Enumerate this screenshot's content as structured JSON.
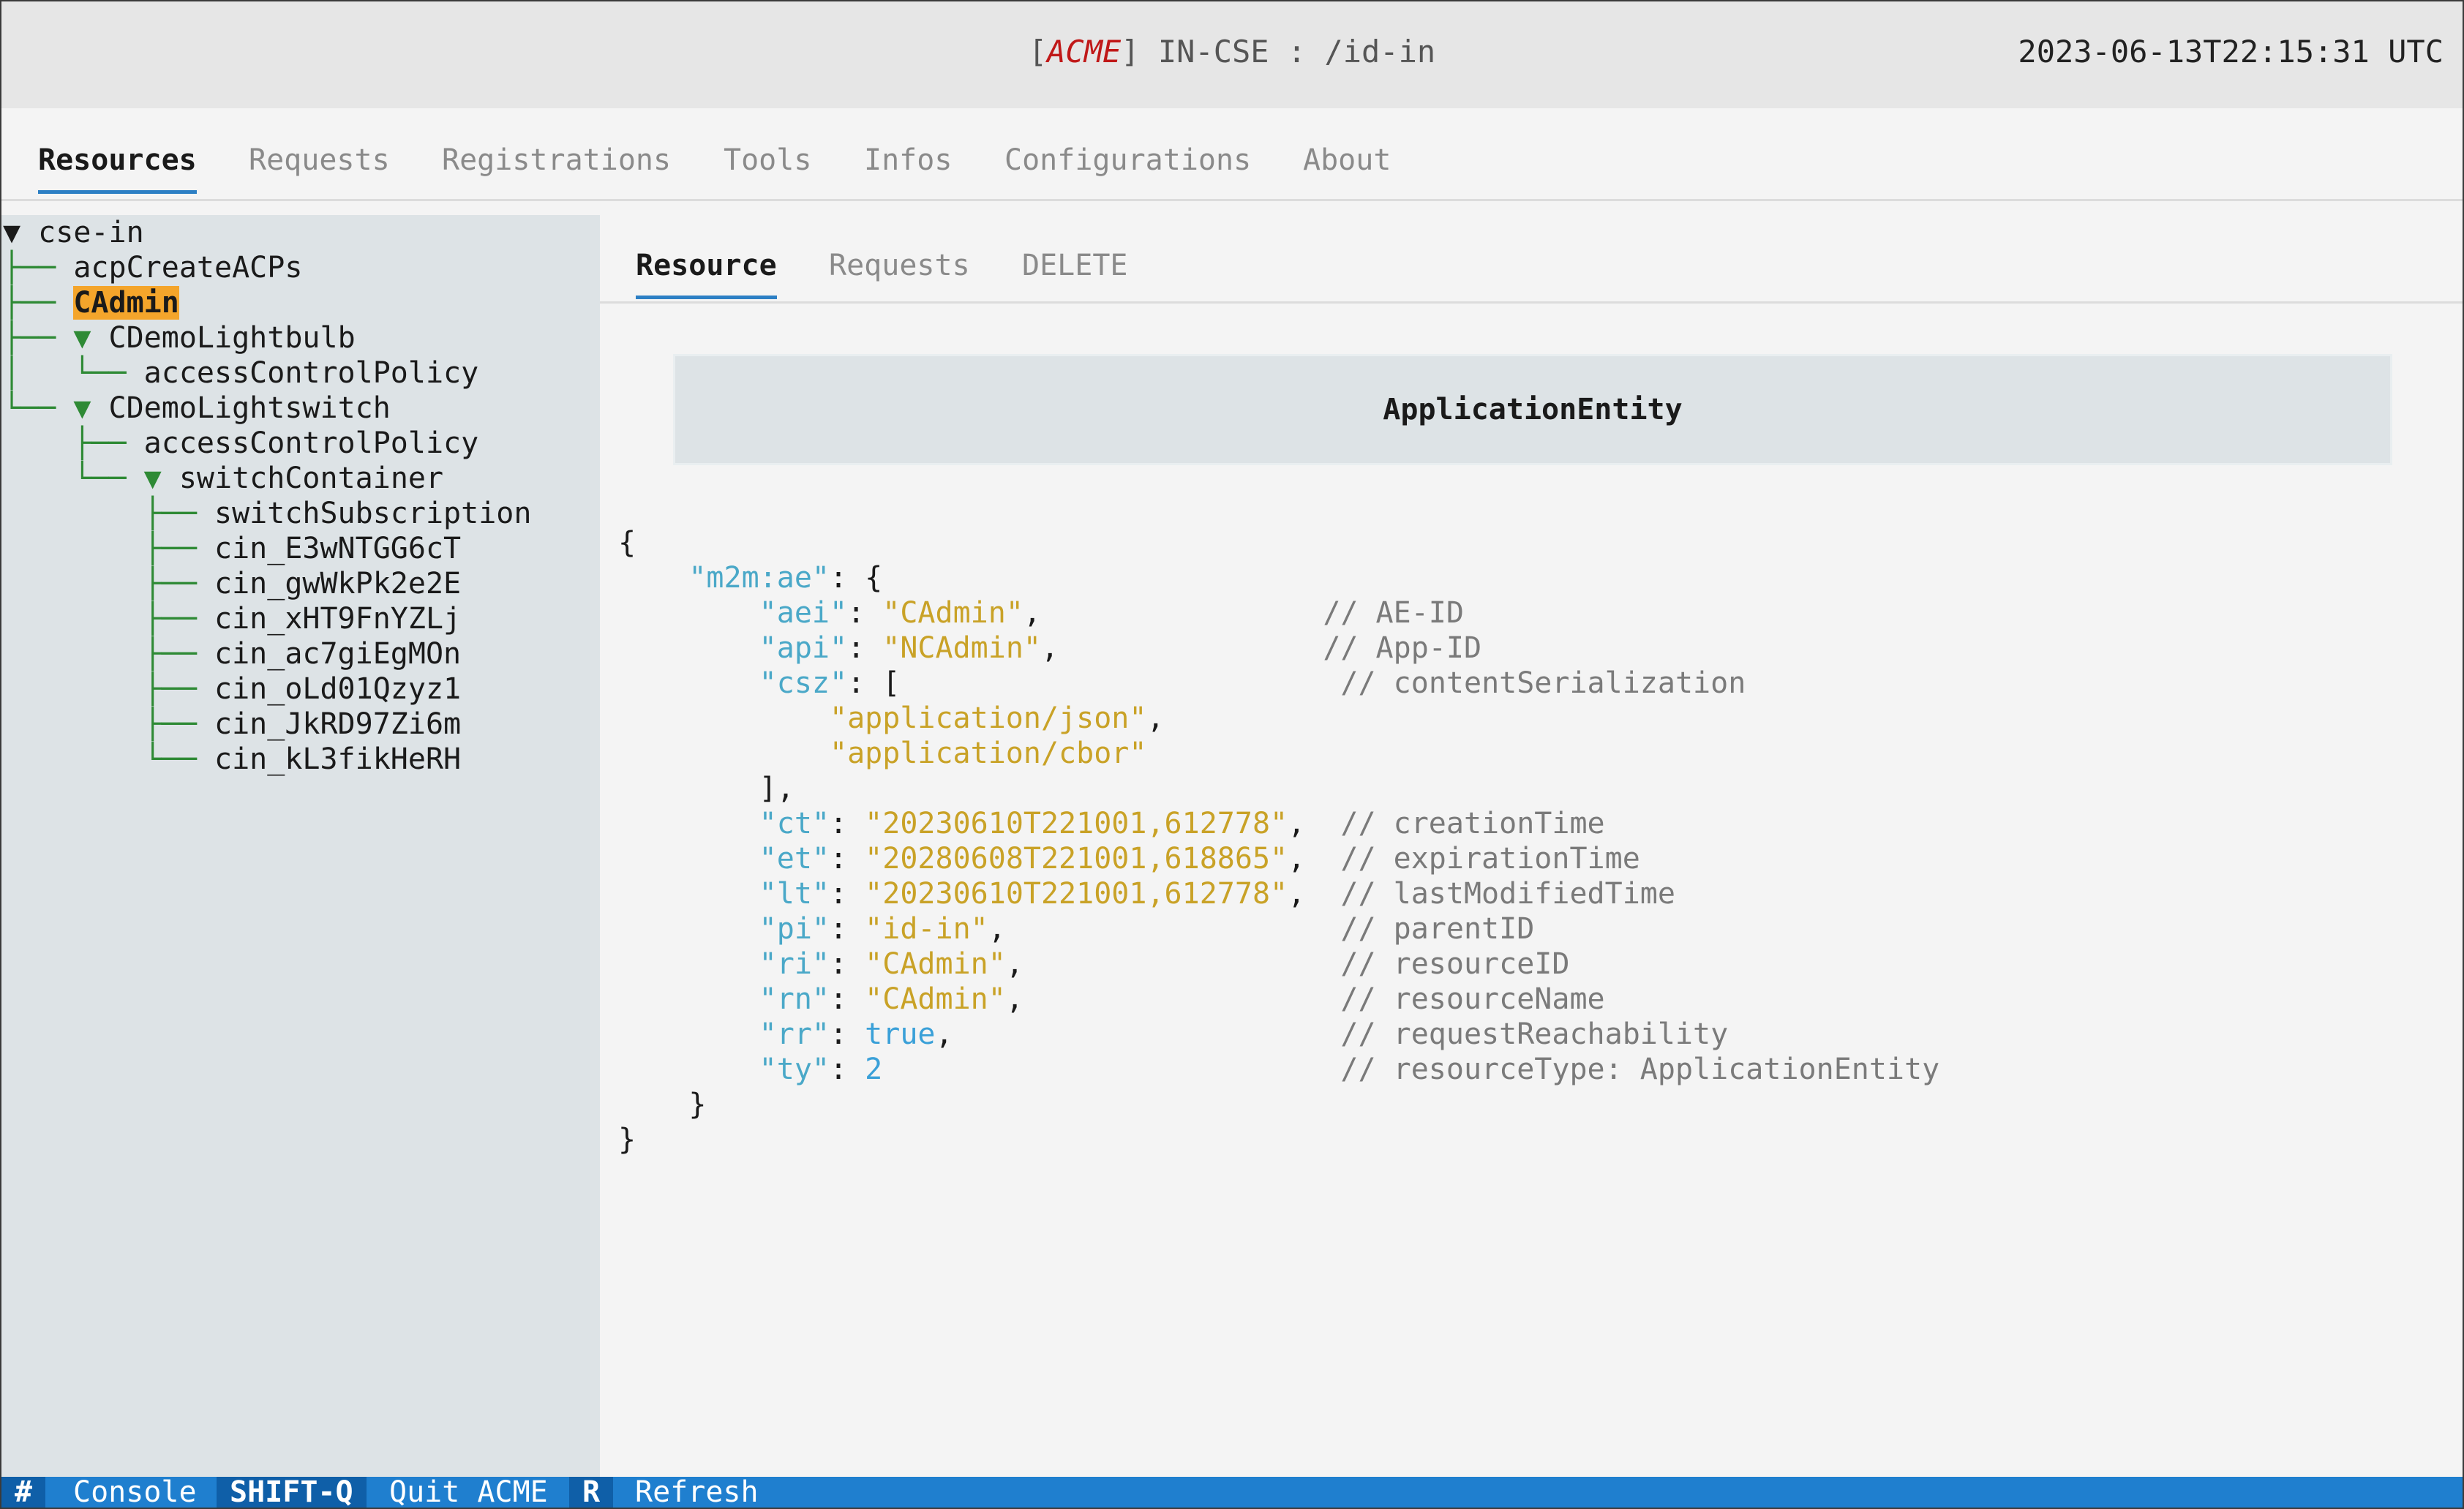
{
  "window": {
    "title_bracket_open": "[",
    "brand": "ACME",
    "title_rest": "] IN-CSE : /id-in",
    "clock": "2023-06-13T22:15:31 UTC"
  },
  "tabs": [
    {
      "label": "Resources",
      "active": true
    },
    {
      "label": "Requests"
    },
    {
      "label": "Registrations"
    },
    {
      "label": "Tools"
    },
    {
      "label": "Infos"
    },
    {
      "label": "Configurations"
    },
    {
      "label": "About"
    }
  ],
  "tree": [
    {
      "prefix": "▼ ",
      "label": "cse-in"
    },
    {
      "prefix": "├── ",
      "label": "acpCreateACPs"
    },
    {
      "prefix": "├── ",
      "label": "CAdmin",
      "selected": true
    },
    {
      "prefix": "├── ▼ ",
      "label": "CDemoLightbulb"
    },
    {
      "prefix": "│   └── ",
      "label": "accessControlPolicy"
    },
    {
      "prefix": "└── ▼ ",
      "label": "CDemoLightswitch"
    },
    {
      "prefix": "    ├── ",
      "label": "accessControlPolicy"
    },
    {
      "prefix": "    └── ▼ ",
      "label": "switchContainer"
    },
    {
      "prefix": "        ├── ",
      "label": "switchSubscription"
    },
    {
      "prefix": "        ├── ",
      "label": "cin_E3wNTGG6cT"
    },
    {
      "prefix": "        ├── ",
      "label": "cin_gwWkPk2e2E"
    },
    {
      "prefix": "        ├── ",
      "label": "cin_xHT9FnYZLj"
    },
    {
      "prefix": "        ├── ",
      "label": "cin_ac7giEgMOn"
    },
    {
      "prefix": "        ├── ",
      "label": "cin_oLd01Qzyz1"
    },
    {
      "prefix": "        ├── ",
      "label": "cin_JkRD97Zi6m"
    },
    {
      "prefix": "        └── ",
      "label": "cin_kL3fikHeRH"
    }
  ],
  "subtabs": [
    {
      "label": "Resource",
      "active": true
    },
    {
      "label": "Requests"
    },
    {
      "label": "DELETE"
    }
  ],
  "resource_type_header": "ApplicationEntity",
  "json_view": {
    "open": "{",
    "root_key": "\"m2m:ae\"",
    "attrs": [
      {
        "key": "\"aei\"",
        "value": "\"CAdmin\"",
        "comment": "// AE-ID"
      },
      {
        "key": "\"api\"",
        "value": "\"NCAdmin\"",
        "comment": "// App-ID"
      },
      {
        "key": "\"csz\"",
        "value": "[",
        "comment": "// contentSerialization"
      },
      {
        "key": "\"ct\"",
        "value": "\"20230610T221001,612778\"",
        "comment": "// creationTime"
      },
      {
        "key": "\"et\"",
        "value": "\"20280608T221001,618865\"",
        "comment": "// expirationTime"
      },
      {
        "key": "\"lt\"",
        "value": "\"20230610T221001,612778\"",
        "comment": "// lastModifiedTime"
      },
      {
        "key": "\"pi\"",
        "value": "\"id-in\"",
        "comment": "// parentID"
      },
      {
        "key": "\"ri\"",
        "value": "\"CAdmin\"",
        "comment": "// resourceID"
      },
      {
        "key": "\"rn\"",
        "value": "\"CAdmin\"",
        "comment": "// resourceName"
      },
      {
        "key": "\"rr\"",
        "value": "true",
        "comment": "// requestReachability"
      },
      {
        "key": "\"ty\"",
        "value": "2",
        "comment": "// resourceType: ApplicationEntity"
      }
    ],
    "csz_items": [
      "\"application/json\"",
      "\"application/cbor\""
    ],
    "close": "}"
  },
  "statusbar": [
    {
      "key": "#",
      "label": "Console"
    },
    {
      "key": "SHIFT-Q",
      "label": "Quit ACME"
    },
    {
      "key": "R",
      "label": "Refresh"
    }
  ]
}
